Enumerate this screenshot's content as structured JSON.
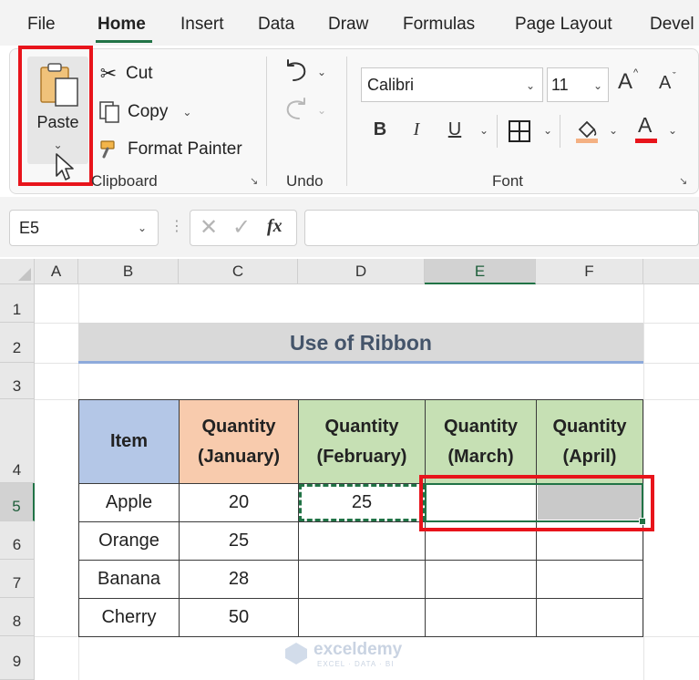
{
  "menu": {
    "tabs": [
      "File",
      "Home",
      "Insert",
      "Data",
      "Draw",
      "Formulas",
      "Page Layout",
      "Devel"
    ]
  },
  "ribbon": {
    "clipboard": {
      "paste_label": "Paste",
      "cut_label": "Cut",
      "copy_label": "Copy",
      "format_painter_label": "Format Painter",
      "group_label": "Clipboard"
    },
    "undo": {
      "group_label": "Undo"
    },
    "font": {
      "font_name": "Calibri",
      "font_size": "11",
      "bold": "B",
      "italic": "I",
      "underline": "U",
      "group_label": "Font",
      "increase_size_glyph": "A",
      "decrease_size_glyph": "A",
      "font_color_glyph": "A"
    }
  },
  "formula_bar": {
    "name_box": "E5",
    "fx_label": "fx",
    "value": ""
  },
  "grid": {
    "columns": [
      "A",
      "B",
      "C",
      "D",
      "E",
      "F"
    ],
    "rows": [
      "1",
      "2",
      "3",
      "4",
      "5",
      "6",
      "7",
      "8",
      "9"
    ],
    "selected_cell": "E5"
  },
  "sheet": {
    "title": "Use of Ribbon",
    "table": {
      "headers": {
        "item": "Item",
        "jan_line1": "Quantity",
        "jan_line2": "(January)",
        "feb_line1": "Quantity",
        "feb_line2": "(February)",
        "mar_line1": "Quantity",
        "mar_line2": "(March)",
        "apr_line1": "Quantity",
        "apr_line2": "(April)"
      },
      "rows": [
        {
          "item": "Apple",
          "jan": "20",
          "feb": "25",
          "mar": "",
          "apr": ""
        },
        {
          "item": "Orange",
          "jan": "25",
          "feb": "",
          "mar": "",
          "apr": ""
        },
        {
          "item": "Banana",
          "jan": "28",
          "feb": "",
          "mar": "",
          "apr": ""
        },
        {
          "item": "Cherry",
          "jan": "50",
          "feb": "",
          "mar": "",
          "apr": ""
        }
      ]
    }
  },
  "watermark": {
    "name": "exceldemy",
    "tagline": "EXCEL · DATA · BI"
  },
  "colors": {
    "accent_green": "#217346",
    "highlight_red": "#e8141b",
    "item_header_fill": "#b4c7e7",
    "january_header_fill": "#f8cbad",
    "green_header_fill": "#c6e0b4",
    "title_fill": "#d9d9d9",
    "title_text": "#44546a",
    "paste_preview_fill": "#c9c9c9"
  }
}
